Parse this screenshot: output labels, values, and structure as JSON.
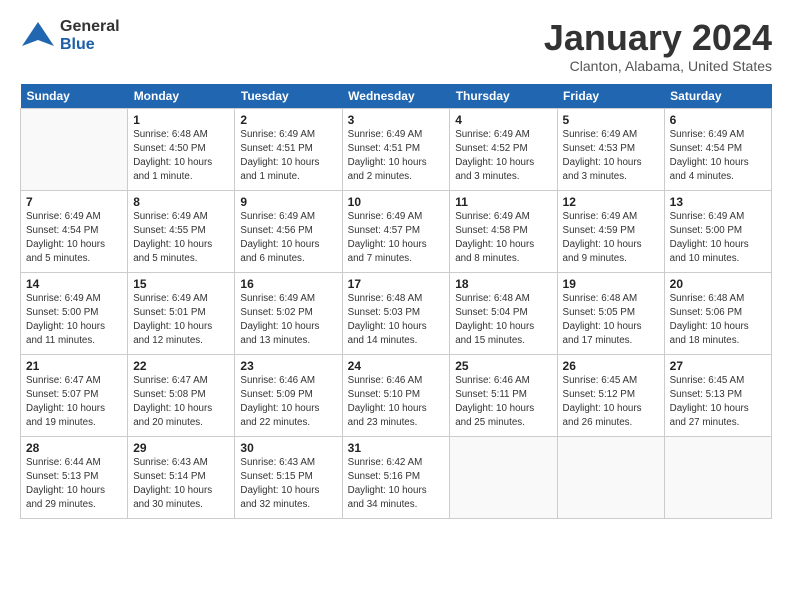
{
  "logo": {
    "general": "General",
    "blue": "Blue"
  },
  "title": "January 2024",
  "subtitle": "Clanton, Alabama, United States",
  "weekdays": [
    "Sunday",
    "Monday",
    "Tuesday",
    "Wednesday",
    "Thursday",
    "Friday",
    "Saturday"
  ],
  "weeks": [
    [
      {
        "day": "",
        "detail": ""
      },
      {
        "day": "1",
        "detail": "Sunrise: 6:48 AM\nSunset: 4:50 PM\nDaylight: 10 hours\nand 1 minute."
      },
      {
        "day": "2",
        "detail": "Sunrise: 6:49 AM\nSunset: 4:51 PM\nDaylight: 10 hours\nand 1 minute."
      },
      {
        "day": "3",
        "detail": "Sunrise: 6:49 AM\nSunset: 4:51 PM\nDaylight: 10 hours\nand 2 minutes."
      },
      {
        "day": "4",
        "detail": "Sunrise: 6:49 AM\nSunset: 4:52 PM\nDaylight: 10 hours\nand 3 minutes."
      },
      {
        "day": "5",
        "detail": "Sunrise: 6:49 AM\nSunset: 4:53 PM\nDaylight: 10 hours\nand 3 minutes."
      },
      {
        "day": "6",
        "detail": "Sunrise: 6:49 AM\nSunset: 4:54 PM\nDaylight: 10 hours\nand 4 minutes."
      }
    ],
    [
      {
        "day": "7",
        "detail": "Sunrise: 6:49 AM\nSunset: 4:54 PM\nDaylight: 10 hours\nand 5 minutes."
      },
      {
        "day": "8",
        "detail": "Sunrise: 6:49 AM\nSunset: 4:55 PM\nDaylight: 10 hours\nand 5 minutes."
      },
      {
        "day": "9",
        "detail": "Sunrise: 6:49 AM\nSunset: 4:56 PM\nDaylight: 10 hours\nand 6 minutes."
      },
      {
        "day": "10",
        "detail": "Sunrise: 6:49 AM\nSunset: 4:57 PM\nDaylight: 10 hours\nand 7 minutes."
      },
      {
        "day": "11",
        "detail": "Sunrise: 6:49 AM\nSunset: 4:58 PM\nDaylight: 10 hours\nand 8 minutes."
      },
      {
        "day": "12",
        "detail": "Sunrise: 6:49 AM\nSunset: 4:59 PM\nDaylight: 10 hours\nand 9 minutes."
      },
      {
        "day": "13",
        "detail": "Sunrise: 6:49 AM\nSunset: 5:00 PM\nDaylight: 10 hours\nand 10 minutes."
      }
    ],
    [
      {
        "day": "14",
        "detail": "Sunrise: 6:49 AM\nSunset: 5:00 PM\nDaylight: 10 hours\nand 11 minutes."
      },
      {
        "day": "15",
        "detail": "Sunrise: 6:49 AM\nSunset: 5:01 PM\nDaylight: 10 hours\nand 12 minutes."
      },
      {
        "day": "16",
        "detail": "Sunrise: 6:49 AM\nSunset: 5:02 PM\nDaylight: 10 hours\nand 13 minutes."
      },
      {
        "day": "17",
        "detail": "Sunrise: 6:48 AM\nSunset: 5:03 PM\nDaylight: 10 hours\nand 14 minutes."
      },
      {
        "day": "18",
        "detail": "Sunrise: 6:48 AM\nSunset: 5:04 PM\nDaylight: 10 hours\nand 15 minutes."
      },
      {
        "day": "19",
        "detail": "Sunrise: 6:48 AM\nSunset: 5:05 PM\nDaylight: 10 hours\nand 17 minutes."
      },
      {
        "day": "20",
        "detail": "Sunrise: 6:48 AM\nSunset: 5:06 PM\nDaylight: 10 hours\nand 18 minutes."
      }
    ],
    [
      {
        "day": "21",
        "detail": "Sunrise: 6:47 AM\nSunset: 5:07 PM\nDaylight: 10 hours\nand 19 minutes."
      },
      {
        "day": "22",
        "detail": "Sunrise: 6:47 AM\nSunset: 5:08 PM\nDaylight: 10 hours\nand 20 minutes."
      },
      {
        "day": "23",
        "detail": "Sunrise: 6:46 AM\nSunset: 5:09 PM\nDaylight: 10 hours\nand 22 minutes."
      },
      {
        "day": "24",
        "detail": "Sunrise: 6:46 AM\nSunset: 5:10 PM\nDaylight: 10 hours\nand 23 minutes."
      },
      {
        "day": "25",
        "detail": "Sunrise: 6:46 AM\nSunset: 5:11 PM\nDaylight: 10 hours\nand 25 minutes."
      },
      {
        "day": "26",
        "detail": "Sunrise: 6:45 AM\nSunset: 5:12 PM\nDaylight: 10 hours\nand 26 minutes."
      },
      {
        "day": "27",
        "detail": "Sunrise: 6:45 AM\nSunset: 5:13 PM\nDaylight: 10 hours\nand 27 minutes."
      }
    ],
    [
      {
        "day": "28",
        "detail": "Sunrise: 6:44 AM\nSunset: 5:13 PM\nDaylight: 10 hours\nand 29 minutes."
      },
      {
        "day": "29",
        "detail": "Sunrise: 6:43 AM\nSunset: 5:14 PM\nDaylight: 10 hours\nand 30 minutes."
      },
      {
        "day": "30",
        "detail": "Sunrise: 6:43 AM\nSunset: 5:15 PM\nDaylight: 10 hours\nand 32 minutes."
      },
      {
        "day": "31",
        "detail": "Sunrise: 6:42 AM\nSunset: 5:16 PM\nDaylight: 10 hours\nand 34 minutes."
      },
      {
        "day": "",
        "detail": ""
      },
      {
        "day": "",
        "detail": ""
      },
      {
        "day": "",
        "detail": ""
      }
    ]
  ]
}
